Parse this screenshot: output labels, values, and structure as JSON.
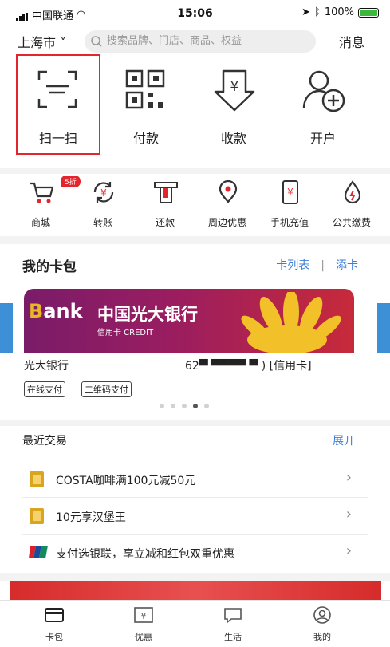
{
  "status_bar": {
    "carrier": "中国联通",
    "time": "15:06",
    "battery": "100%"
  },
  "header": {
    "city": "上海市",
    "search_placeholder": "搜索品牌、门店、商品、权益",
    "messages": "消息"
  },
  "quick_actions": [
    {
      "label": "扫一扫",
      "icon": "scan-icon"
    },
    {
      "label": "付款",
      "icon": "qrcode-icon"
    },
    {
      "label": "收款",
      "icon": "receive-icon"
    },
    {
      "label": "开户",
      "icon": "add-user-icon"
    }
  ],
  "services": [
    {
      "label": "商城",
      "icon": "cart-icon",
      "badge": "5折"
    },
    {
      "label": "转账",
      "icon": "transfer-icon"
    },
    {
      "label": "还款",
      "icon": "repay-icon"
    },
    {
      "label": "周边优惠",
      "icon": "location-icon"
    },
    {
      "label": "手机充值",
      "icon": "phone-recharge-icon"
    },
    {
      "label": "公共缴费",
      "icon": "water-drop-icon"
    }
  ],
  "wallet": {
    "title": "我的卡包",
    "card_list": "卡列表",
    "sep": "|",
    "add_card": "添卡",
    "card": {
      "logo_b": "B",
      "logo_rest": "ank",
      "bank_cn": "中国光大银行",
      "subtitle": "信用卡 CREDIT",
      "name": "光大银行",
      "number": "62▀ ▀▀▀▀   ▀   ) [信用卡]",
      "tags": [
        "在线支付",
        "二维码支付"
      ]
    },
    "pager": {
      "count": 5,
      "active": 3
    }
  },
  "recent": {
    "title": "最近交易",
    "more": "展开",
    "items": [
      {
        "text": "COSTA咖啡满100元减50元",
        "icon": "coupon-gold-icon"
      },
      {
        "text": "10元享汉堡王",
        "icon": "coupon-gold-icon"
      },
      {
        "text": "支付选银联，享立减和红包双重优惠",
        "icon": "unionpay-icon"
      }
    ]
  },
  "tabs": [
    {
      "label": "卡包",
      "icon": "card-icon"
    },
    {
      "label": "优惠",
      "icon": "coupon-icon"
    },
    {
      "label": "生活",
      "icon": "chat-icon"
    },
    {
      "label": "我的",
      "icon": "user-icon"
    }
  ],
  "colors": {
    "accent": "#e3262d",
    "link": "#3b7dd8"
  }
}
